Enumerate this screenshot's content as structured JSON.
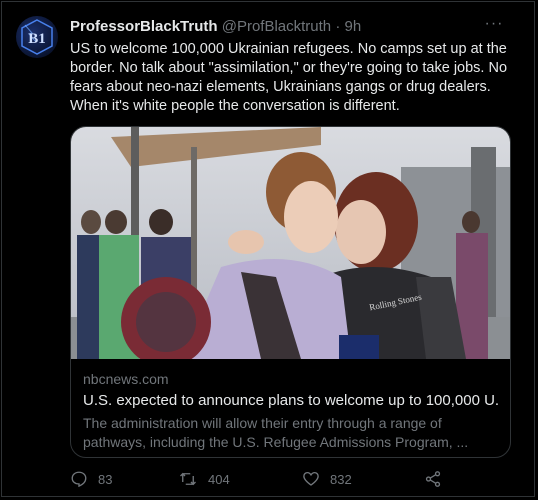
{
  "tweet": {
    "display_name": "ProfessorBlackTruth",
    "handle": "@ProfBlacktruth",
    "separator": "·",
    "time": "9h",
    "more_label": "···",
    "text": "US to welcome 100,000 Ukrainian refugees. No camps set up at the border. No talk about \"assimilation,\" or they're going to take jobs. No fears about neo-nazi elements, Ukrainians gangs or drug dealers. When it's white people the conversation is different.",
    "avatar_text": "B1"
  },
  "card": {
    "domain": "nbcnews.com",
    "title": "U.S. expected to announce plans to welcome up to 100,000 U...",
    "description": "The administration will allow their entry through a range of pathways, including the U.S. Refugee Admissions Program, ...",
    "shirt_text": "Rolling Stones"
  },
  "actions": {
    "replies": "83",
    "retweets": "404",
    "likes": "832"
  },
  "icons": {
    "reply": "reply-icon",
    "retweet": "retweet-icon",
    "like": "heart-icon",
    "share": "share-icon"
  }
}
